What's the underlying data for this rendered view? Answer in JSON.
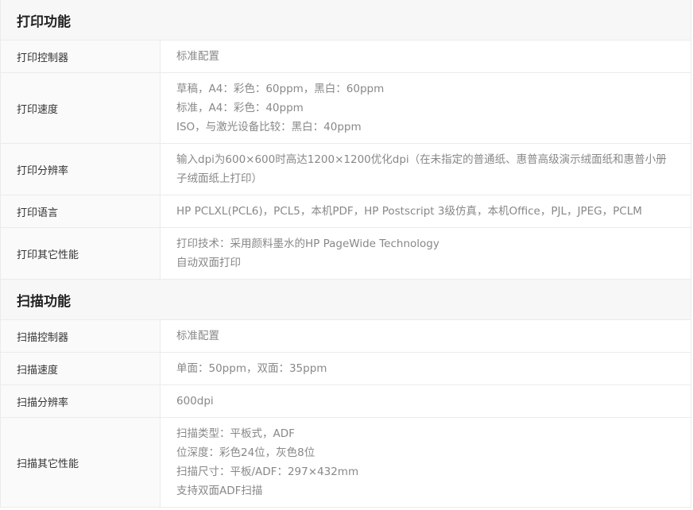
{
  "sections": [
    {
      "title": "打印功能",
      "rows": [
        {
          "label": "打印控制器",
          "lines": [
            "标准配置"
          ]
        },
        {
          "label": "打印速度",
          "lines": [
            "草稿，A4：彩色：60ppm，黑白：60ppm",
            "标准，A4：彩色：40ppm",
            "ISO，与激光设备比较：黑白：40ppm"
          ]
        },
        {
          "label": "打印分辨率",
          "lines": [
            "输入dpi为600×600时高达1200×1200优化dpi（在未指定的普通纸、惠普高级演示绒面纸和惠普小册子绒面纸上打印）"
          ]
        },
        {
          "label": "打印语言",
          "lines": [
            "HP PCLXL(PCL6)，PCL5，本机PDF，HP Postscript 3级仿真，本机Office，PJL，JPEG，PCLM"
          ]
        },
        {
          "label": "打印其它性能",
          "lines": [
            "打印技术：采用颜料墨水的HP PageWide Technology",
            "自动双面打印"
          ]
        }
      ]
    },
    {
      "title": "扫描功能",
      "rows": [
        {
          "label": "扫描控制器",
          "lines": [
            "标准配置"
          ]
        },
        {
          "label": "扫描速度",
          "lines": [
            "单面：50ppm，双面：35ppm"
          ]
        },
        {
          "label": "扫描分辨率",
          "lines": [
            "600dpi"
          ]
        },
        {
          "label": "扫描其它性能",
          "lines": [
            "扫描类型：平板式，ADF",
            "位深度：彩色24位，灰色8位",
            "扫描尺寸：平板/ADF：297×432mm",
            "支持双面ADF扫描"
          ]
        }
      ]
    }
  ]
}
